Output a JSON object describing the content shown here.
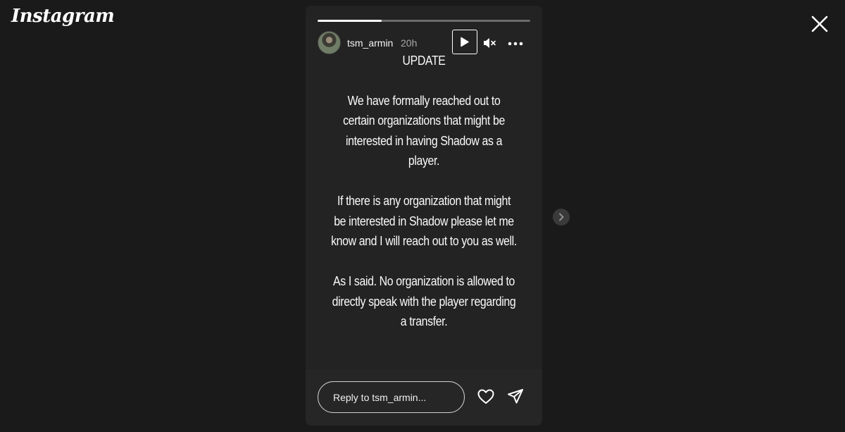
{
  "brand": {
    "logo_text": "Instagram"
  },
  "story": {
    "username": "tsm_armin",
    "timestamp": "20h",
    "progress": 0.3,
    "text": {
      "heading": "UPDATE",
      "paragraph_1": "We have formally reached out to certain organizations that might be interested in having Shadow as a player.",
      "paragraph_2": "If there is any organization that might be interested in Shadow please let me know and I will reach out to you as well.",
      "paragraph_3": "As I said. No organization is allowed to directly speak with the player regarding a transfer."
    }
  },
  "controls": {
    "play_icon": "play-icon",
    "mute_icon": "speaker-muted-icon",
    "more_icon": "more-horizontal-icon",
    "close_icon": "close-icon",
    "next_icon": "chevron-right-icon"
  },
  "reply": {
    "placeholder": "Reply to tsm_armin...",
    "like_icon": "heart-icon",
    "share_icon": "send-icon"
  },
  "colors": {
    "background": "#1a1a1a",
    "story_background": "#232323",
    "text": "#fafafa",
    "muted_text": "#a8a8a8"
  }
}
